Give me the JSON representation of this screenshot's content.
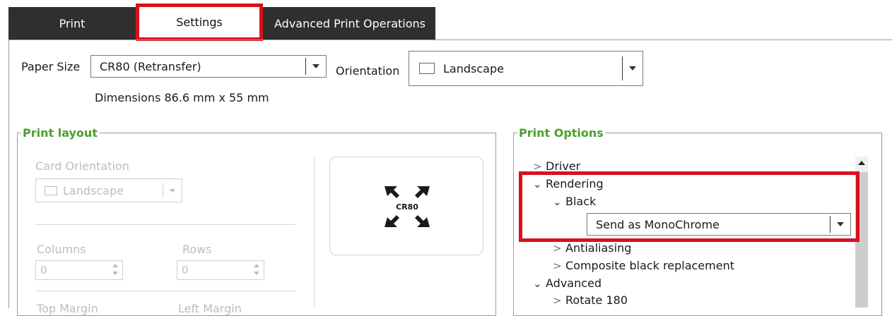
{
  "tabs": [
    {
      "label": "Print"
    },
    {
      "label": "Settings"
    },
    {
      "label": "Advanced Print Operations"
    }
  ],
  "paper": {
    "label": "Paper Size",
    "value": "CR80 (Retransfer)",
    "dimensions": "Dimensions 86.6 mm x 55 mm"
  },
  "orientation": {
    "label": "Orientation",
    "value": "Landscape"
  },
  "print_layout": {
    "title": "Print layout",
    "card_orientation_label": "Card Orientation",
    "card_orientation_value": "Landscape",
    "columns_label": "Columns",
    "columns_value": "0",
    "rows_label": "Rows",
    "rows_value": "0",
    "top_margin_label": "Top Margin",
    "left_margin_label": "Left Margin",
    "card_label": "CR80"
  },
  "print_options": {
    "title": "Print Options",
    "tree": {
      "driver": "Driver",
      "rendering": "Rendering",
      "black": "Black",
      "black_mode": "Send as MonoChrome",
      "antialiasing": "Antialiasing",
      "composite": "Composite black replacement",
      "advanced": "Advanced",
      "rotate": "Rotate 180"
    }
  },
  "colors": {
    "highlight": "#d9101f",
    "group_title": "#4aa02c",
    "tab_dark": "#2f2f2f"
  }
}
